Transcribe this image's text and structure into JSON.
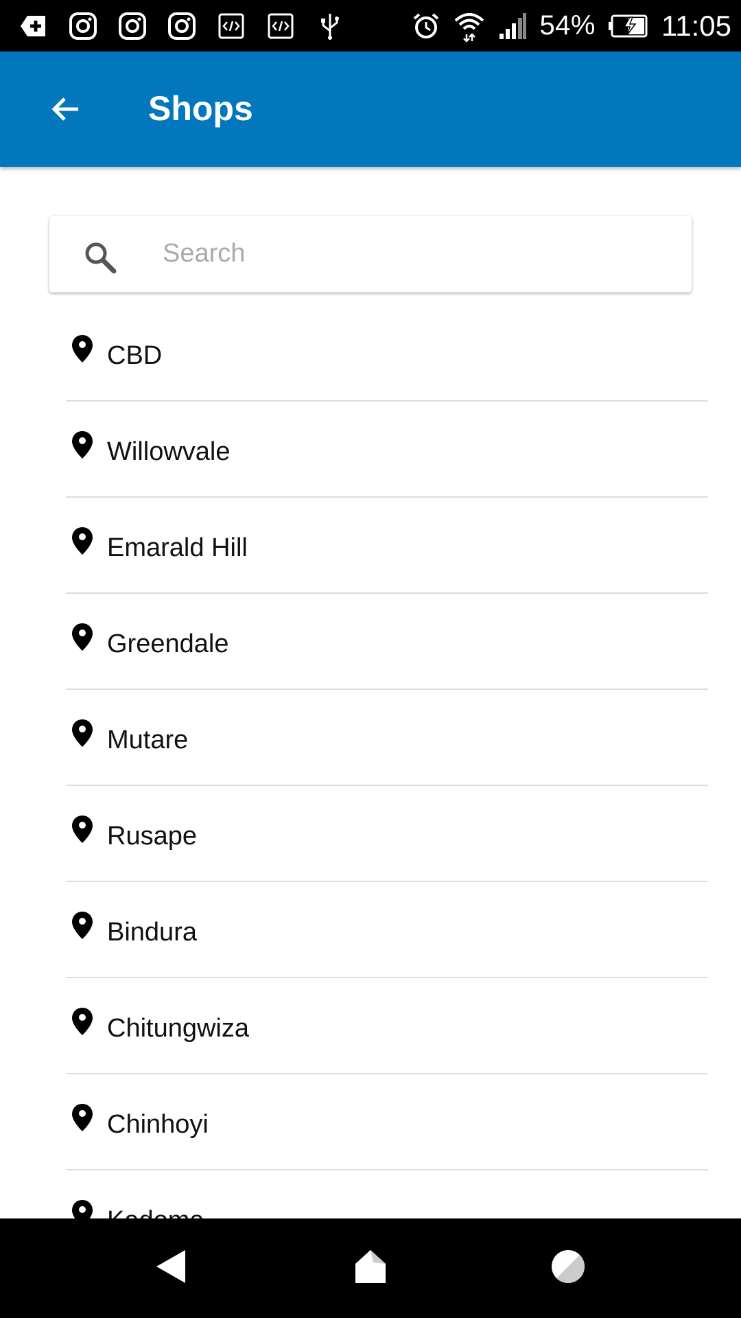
{
  "status_bar": {
    "battery_percent": "54%",
    "time": "11:05",
    "icons": [
      "add-notification-icon",
      "instagram-icon",
      "instagram-icon",
      "instagram-icon",
      "code-icon",
      "code-icon",
      "usb-icon",
      "alarm-icon",
      "wifi-icon",
      "signal-icon",
      "battery-charging-icon"
    ]
  },
  "header": {
    "title": "Shops",
    "back_icon": "arrow-left-icon",
    "background_color": "#0277BD"
  },
  "search": {
    "placeholder": "Search",
    "value": "",
    "icon": "search-icon"
  },
  "shops": [
    {
      "name": "CBD"
    },
    {
      "name": "Willowvale"
    },
    {
      "name": "Emarald Hill"
    },
    {
      "name": "Greendale"
    },
    {
      "name": "Mutare"
    },
    {
      "name": "Rusape"
    },
    {
      "name": "Bindura"
    },
    {
      "name": "Chitungwiza"
    },
    {
      "name": "Chinhoyi"
    },
    {
      "name": "Kadoma"
    }
  ],
  "nav_bar": {
    "buttons": [
      "back-nav-icon",
      "home-nav-icon",
      "recents-nav-icon"
    ]
  }
}
